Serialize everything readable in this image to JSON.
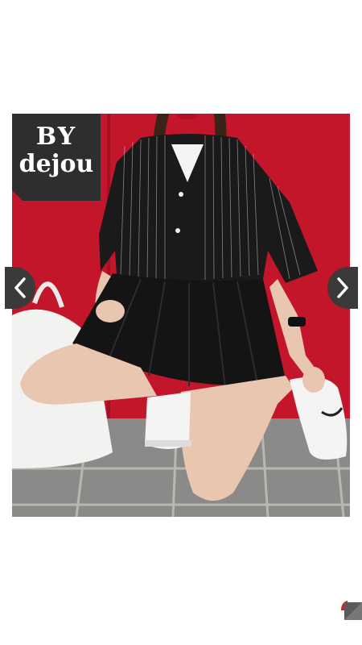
{
  "viewer": {
    "watermark": {
      "line1": "BY",
      "line2": "dejou"
    },
    "photo_description_icon": "photo-content",
    "prev_icon": "chevron-left-icon",
    "next_icon": "chevron-right-icon",
    "corner_icon": "corner-badge-icon"
  },
  "colors": {
    "background": "#ffffff",
    "wall": "#c4162a",
    "floor": "#8c8a88",
    "nav_button": "#3a3a3a",
    "watermark_bg": "#2e2e2e"
  }
}
